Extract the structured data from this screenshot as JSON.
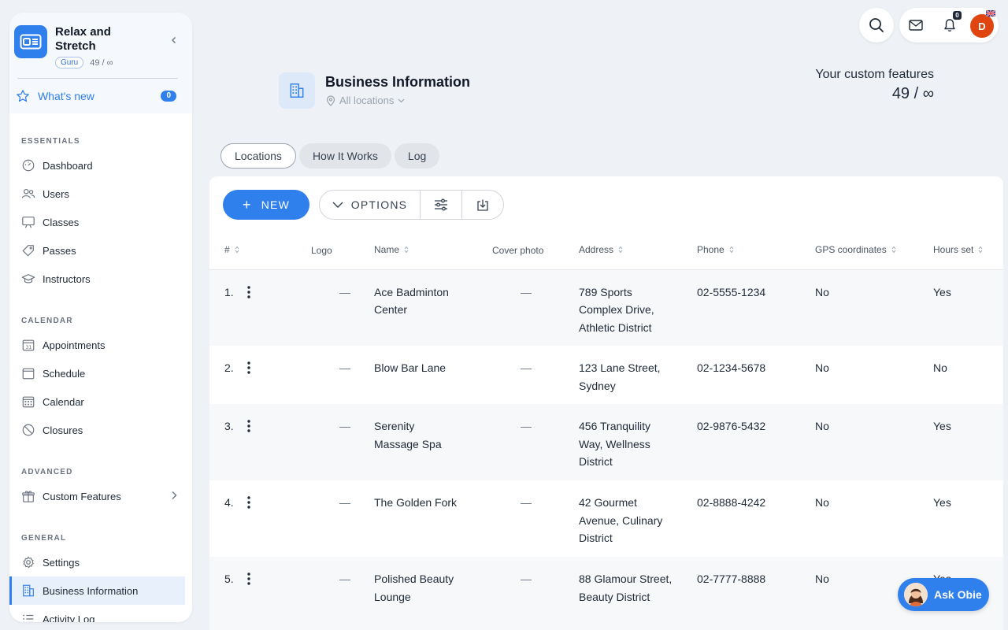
{
  "sidebar": {
    "brand_name": "Relax and Stretch",
    "plan_badge": "Guru",
    "feature_count": "49 / ∞",
    "whats_new_label": "What's new",
    "whats_new_count": "0",
    "sections": {
      "essentials": "ESSENTIALS",
      "calendar": "CALENDAR",
      "advanced": "ADVANCED",
      "general": "GENERAL"
    },
    "essentials": [
      "Dashboard",
      "Users",
      "Classes",
      "Passes",
      "Instructors"
    ],
    "calendar": [
      "Appointments",
      "Schedule",
      "Calendar",
      "Closures"
    ],
    "advanced": [
      "Custom Features"
    ],
    "general": [
      "Settings",
      "Business Information",
      "Activity Log"
    ]
  },
  "topbar": {
    "notification_count": "0",
    "avatar_initial": "D"
  },
  "header": {
    "title": "Business Information",
    "location_filter": "All locations",
    "custom_features_label": "Your custom features",
    "custom_features_value": "49 / ∞"
  },
  "tabs": [
    "Locations",
    "How It Works",
    "Log"
  ],
  "toolbar": {
    "new_label": "NEW",
    "options_label": "OPTIONS"
  },
  "table": {
    "columns": [
      "#",
      "Logo",
      "Name",
      "Cover photo",
      "Address",
      "Phone",
      "GPS coordinates",
      "Hours set"
    ],
    "rows": [
      {
        "num": "1.",
        "logo": "—",
        "name": "Ace Badminton Center",
        "cover": "—",
        "address": "789 Sports Complex Drive, Athletic District",
        "phone": "02-5555-1234",
        "gps": "No",
        "hours": "Yes"
      },
      {
        "num": "2.",
        "logo": "—",
        "name": "Blow Bar Lane",
        "cover": "—",
        "address": "123 Lane Street, Sydney",
        "phone": "02-1234-5678",
        "gps": "No",
        "hours": "No"
      },
      {
        "num": "3.",
        "logo": "—",
        "name": "Serenity Massage Spa",
        "cover": "—",
        "address": "456 Tranquility Way, Wellness District",
        "phone": "02-9876-5432",
        "gps": "No",
        "hours": "Yes"
      },
      {
        "num": "4.",
        "logo": "—",
        "name": "The Golden Fork",
        "cover": "—",
        "address": "42 Gourmet Avenue, Culinary District",
        "phone": "02-8888-4242",
        "gps": "No",
        "hours": "Yes"
      },
      {
        "num": "5.",
        "logo": "—",
        "name": "Polished Beauty Lounge",
        "cover": "—",
        "address": "88 Glamour Street, Beauty District",
        "phone": "02-7777-8888",
        "gps": "No",
        "hours": "Yes"
      }
    ]
  },
  "ask_obie_label": "Ask Obie",
  "colors": {
    "accent": "#2f80ed",
    "avatar": "#e1450f",
    "background": "#eef1f5"
  },
  "icons": {
    "brand": "window-logo-icon",
    "search": "search-icon",
    "mail": "mail-icon",
    "bell": "bell-icon",
    "page": "building-icon"
  }
}
